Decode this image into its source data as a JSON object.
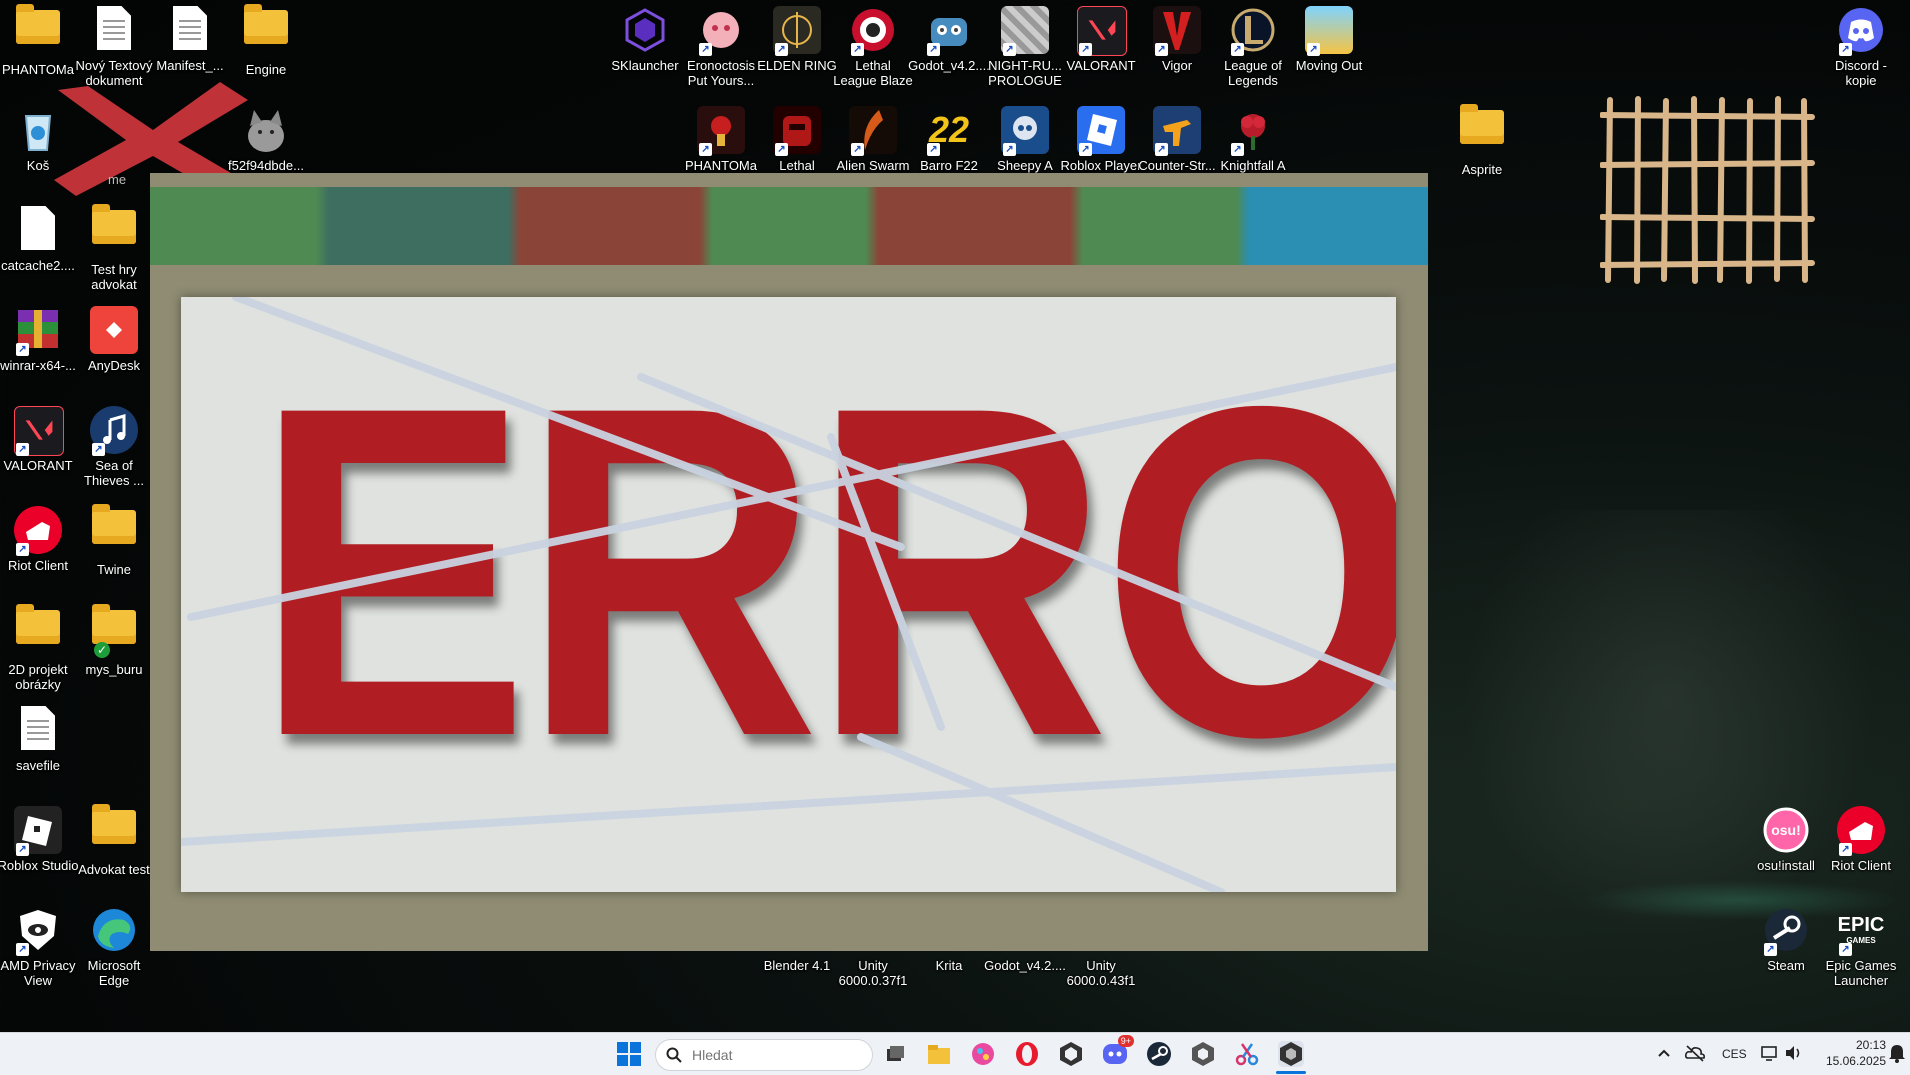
{
  "desktop": {
    "icons_left": [
      {
        "label": "PHANTOMa",
        "icon": "folder-icon"
      },
      {
        "label": "Nový Textový dokument",
        "icon": "text-document-icon"
      },
      {
        "label": "Manifest_...",
        "icon": "text-document-icon"
      },
      {
        "label": "Engine",
        "icon": "folder-icon"
      },
      {
        "label": "Koš",
        "icon": "recycle-bin-icon"
      },
      {
        "label": "f52f94dbde...",
        "icon": "cat-image-icon"
      },
      {
        "label": "catcache2....",
        "icon": "file-icon"
      },
      {
        "label": "Test hry advokat",
        "icon": "folder-icon"
      },
      {
        "label": "winrar-x64-...",
        "icon": "winrar-icon"
      },
      {
        "label": "AnyDesk",
        "icon": "anydesk-icon"
      },
      {
        "label": "VALORANT",
        "icon": "valorant-icon"
      },
      {
        "label": "Sea of Thieves ...",
        "icon": "music-icon"
      },
      {
        "label": "Riot Client",
        "icon": "riot-client-icon"
      },
      {
        "label": "Twine",
        "icon": "folder-icon"
      },
      {
        "label": "2D projekt obrázky",
        "icon": "folder-icon"
      },
      {
        "label": "mys_buru",
        "icon": "folder-synced-icon"
      },
      {
        "label": "savefile",
        "icon": "text-document-icon"
      },
      {
        "label": "Roblox Studio",
        "icon": "roblox-studio-icon"
      },
      {
        "label": "Advokat test",
        "icon": "folder-icon"
      },
      {
        "label": "AMD Privacy View",
        "icon": "amd-privacy-icon"
      },
      {
        "label": "Microsoft Edge",
        "icon": "edge-icon"
      }
    ],
    "icons_top_row1": [
      {
        "label": "SKlauncher",
        "icon": "sklauncher-icon"
      },
      {
        "label": "Eronoctosis Put Yours...",
        "icon": "eronoctosis-icon"
      },
      {
        "label": "ELDEN RING",
        "icon": "elden-ring-icon"
      },
      {
        "label": "Lethal League Blaze",
        "icon": "lethal-league-icon"
      },
      {
        "label": "Godot_v4.2....",
        "icon": "godot-icon"
      },
      {
        "label": "NIGHT-RU... PROLOGUE",
        "icon": "night-runners-icon"
      },
      {
        "label": "VALORANT",
        "icon": "valorant-icon"
      },
      {
        "label": "Vigor",
        "icon": "vigor-icon"
      },
      {
        "label": "League of Legends",
        "icon": "league-icon"
      },
      {
        "label": "Moving Out",
        "icon": "moving-out-icon"
      }
    ],
    "icons_top_row2": [
      {
        "label": "PHANTOMa",
        "icon": "phantoma-icon"
      },
      {
        "label": "Lethal",
        "icon": "lethal-icon"
      },
      {
        "label": "Alien Swarm",
        "icon": "alien-swarm-icon"
      },
      {
        "label": "Barro F22",
        "icon": "barro-icon"
      },
      {
        "label": "Sheepy A",
        "icon": "sheepy-icon"
      },
      {
        "label": "Roblox Player",
        "icon": "roblox-icon"
      },
      {
        "label": "Counter-Str...",
        "icon": "counter-strike-icon"
      },
      {
        "label": "Knightfall A",
        "icon": "knightfall-icon"
      }
    ],
    "icons_bottom_row": [
      {
        "label": "Blender 4.1",
        "icon": "blender-icon"
      },
      {
        "label": "Unity 6000.0.37f1",
        "icon": "unity-icon"
      },
      {
        "label": "Krita",
        "icon": "krita-icon"
      },
      {
        "label": "Godot_v4.2....",
        "icon": "godot-icon"
      },
      {
        "label": "Unity 6000.0.43f1",
        "icon": "unity-icon"
      }
    ],
    "icons_right": [
      {
        "label": "Discord - kopie",
        "icon": "discord-icon"
      },
      {
        "label": "Asprite",
        "icon": "folder-icon"
      },
      {
        "label": "osu!install",
        "icon": "osu-icon"
      },
      {
        "label": "Riot Client",
        "icon": "riot-client-icon"
      },
      {
        "label": "Steam",
        "icon": "steam-icon"
      },
      {
        "label": "Epic Games Launcher",
        "icon": "epic-games-icon"
      }
    ],
    "overlay_x_label": "me"
  },
  "error_window": {
    "text": "ERROR"
  },
  "taskbar": {
    "search_placeholder": "Hledat",
    "apps": [
      "start-icon",
      "search-icon",
      "task-view-icon",
      "file-explorer-icon",
      "paint-icon",
      "opera-icon",
      "unity-hub-icon",
      "discord-icon",
      "steam-icon",
      "unity-icon",
      "snipping-tool-icon",
      "unity-active-icon"
    ],
    "discord_badge": "9+",
    "language": "CES",
    "time": "20:13",
    "date": "15.06.2025"
  }
}
